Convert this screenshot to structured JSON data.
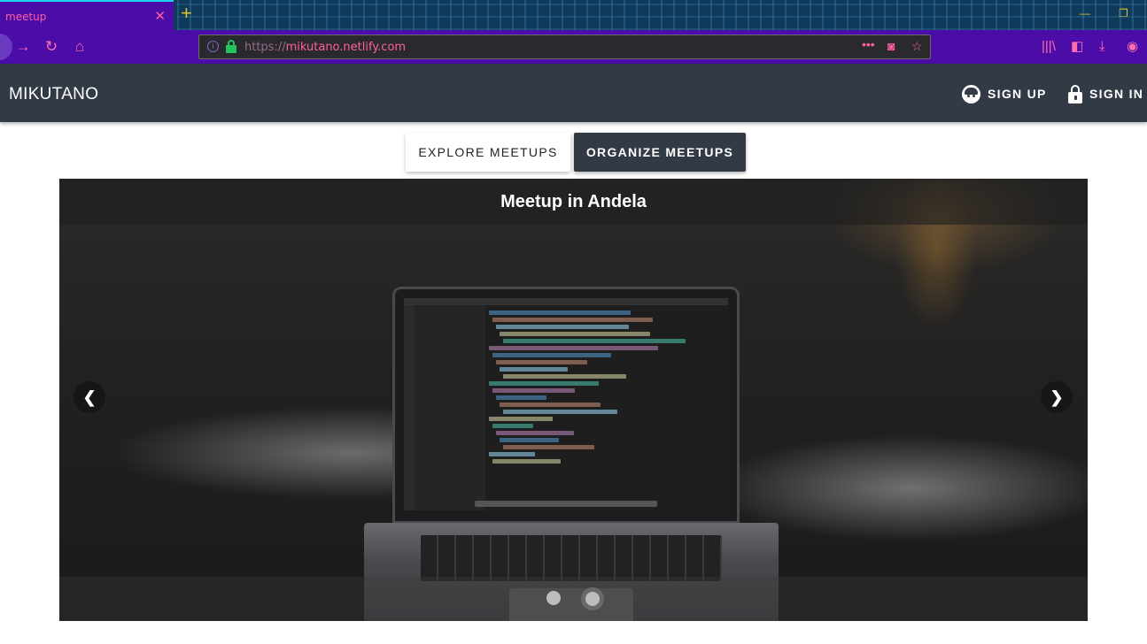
{
  "browser": {
    "tab_title": "meetup",
    "tab_close": "✕",
    "new_tab": "+",
    "minimize": "—",
    "restore": "❐",
    "url_scheme": "https://",
    "url_host": "mikutano.netlify.com",
    "page_actions": "•••",
    "colors": {
      "chrome": "#4b0ca8",
      "accent": "#ff5fa2"
    }
  },
  "header": {
    "brand": "MIKUTANO",
    "sign_up": "SIGN UP",
    "sign_in": "SIGN IN"
  },
  "actions": {
    "explore": "EXPLORE MEETUPS",
    "organize": "ORGANIZE MEETUPS"
  },
  "carousel": {
    "slide_title": "Meetup in Andela",
    "slide_count": 2,
    "active_slide": 2,
    "prev_icon": "chevron-left-icon",
    "next_icon": "chevron-right-icon"
  }
}
